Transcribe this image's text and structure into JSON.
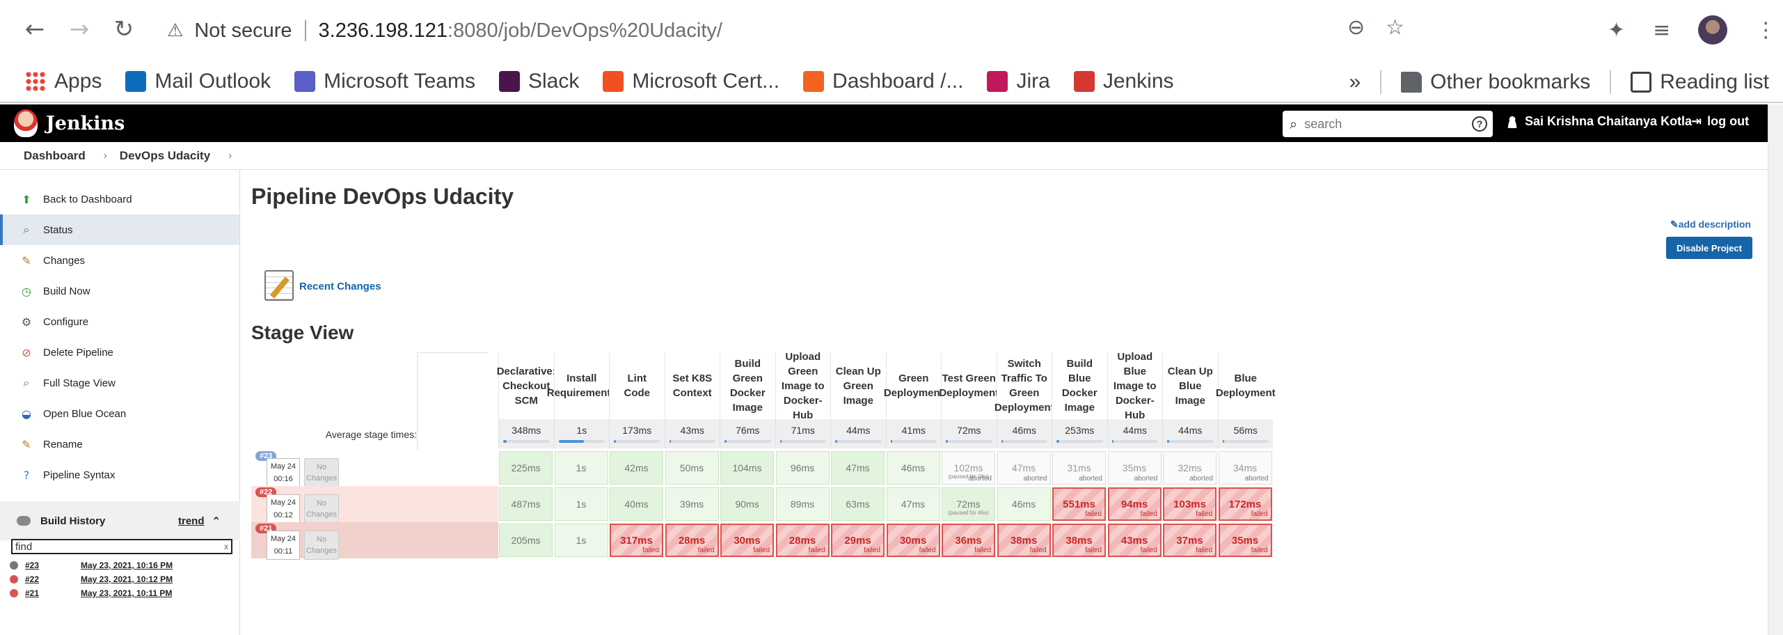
{
  "browser": {
    "security_label": "Not secure",
    "url_host": "3.236.198.121",
    "url_path": ":8080/job/DevOps%20Udacity/",
    "bookmarks": [
      {
        "label": "Apps",
        "color": "#ea4335"
      },
      {
        "label": "Mail Outlook",
        "color": "#0f6cbd"
      },
      {
        "label": "Microsoft Teams",
        "color": "#5b5fc7"
      },
      {
        "label": "Slack",
        "color": "#4a154b"
      },
      {
        "label": "Microsoft Cert...",
        "color": "#f25022"
      },
      {
        "label": "Dashboard /...",
        "color": "#f26322"
      },
      {
        "label": "Jira",
        "color": "#c2185b"
      },
      {
        "label": "Jenkins",
        "color": "#d33833"
      }
    ],
    "overflow": "»",
    "other_bookmarks": "Other bookmarks",
    "reading_list": "Reading list"
  },
  "jenkins": {
    "title": "Jenkins",
    "search_placeholder": "search",
    "help": "?",
    "user": "Sai Krishna Chaitanya Kotla",
    "logout": "log out"
  },
  "breadcrumb": {
    "root": "Dashboard",
    "job": "DevOps Udacity",
    "sep": "›"
  },
  "sidebar": {
    "tasks": [
      {
        "label": "Back to Dashboard",
        "icon": "up-arrow-icon"
      },
      {
        "label": "Status",
        "icon": "magnifier-icon"
      },
      {
        "label": "Changes",
        "icon": "notepad-icon"
      },
      {
        "label": "Build Now",
        "icon": "clock-icon"
      },
      {
        "label": "Configure",
        "icon": "gear-icon"
      },
      {
        "label": "Delete Pipeline",
        "icon": "no-entry-icon"
      },
      {
        "label": "Full Stage View",
        "icon": "magnifier-icon"
      },
      {
        "label": "Open Blue Ocean",
        "icon": "blue-ocean-icon"
      },
      {
        "label": "Rename",
        "icon": "notepad-icon"
      },
      {
        "label": "Pipeline Syntax",
        "icon": "help-icon"
      }
    ],
    "build_history": {
      "title": "Build History",
      "trend": "trend",
      "find_value": "find",
      "clear": "x",
      "builds": [
        {
          "number": "#23",
          "date": "May 23, 2021, 10:16 PM",
          "status_color": "#777777"
        },
        {
          "number": "#22",
          "date": "May 23, 2021, 10:12 PM",
          "status_color": "#d9534f"
        },
        {
          "number": "#21",
          "date": "May 23, 2021, 10:11 PM",
          "status_color": "#d9534f"
        }
      ]
    }
  },
  "main": {
    "title": "Pipeline DevOps Udacity",
    "add_description": "add description",
    "disable_button": "Disable Project",
    "recent_changes": "Recent Changes",
    "stage_view_title": "Stage View",
    "avg_label": "Average stage times:",
    "stages": [
      {
        "name": "Declarative: Checkout SCM",
        "avg": "348ms",
        "bar": 0.08
      },
      {
        "name": "Install Requirements",
        "avg": "1s",
        "bar": 0.55
      },
      {
        "name": "Lint Code",
        "avg": "173ms",
        "bar": 0.05
      },
      {
        "name": "Set K8S Context",
        "avg": "43ms",
        "bar": 0.02
      },
      {
        "name": "Build Green Docker Image",
        "avg": "76ms",
        "bar": 0.03
      },
      {
        "name": "Upload Green Image to Docker-Hub",
        "avg": "71ms",
        "bar": 0.03
      },
      {
        "name": "Clean Up Green Image",
        "avg": "44ms",
        "bar": 0.02
      },
      {
        "name": "Green Deployment",
        "avg": "41ms",
        "bar": 0.02
      },
      {
        "name": "Test Green Deployment",
        "avg": "72ms",
        "bar": 0.03
      },
      {
        "name": "Switch Traffic To Green Deployment",
        "avg": "46ms",
        "bar": 0.02
      },
      {
        "name": "Build Blue Docker Image",
        "avg": "253ms",
        "bar": 0.06
      },
      {
        "name": "Upload Blue Image to Docker-Hub",
        "avg": "44ms",
        "bar": 0.02
      },
      {
        "name": "Clean Up Blue Image",
        "avg": "44ms",
        "bar": 0.02
      },
      {
        "name": "Blue Deployment",
        "avg": "56ms",
        "bar": 0.02
      }
    ],
    "runs": [
      {
        "badge": "#23",
        "badge_color": "#7fa6d6",
        "date": "May 24",
        "time": "00:16",
        "changes": "No Changes",
        "row_color": "#ffffff",
        "cells": [
          {
            "t": "225ms",
            "s": "ok"
          },
          {
            "t": "1s",
            "s": "ok2"
          },
          {
            "t": "42ms",
            "s": "ok"
          },
          {
            "t": "50ms",
            "s": "ok2"
          },
          {
            "t": "104ms",
            "s": "ok"
          },
          {
            "t": "96ms",
            "s": "ok2"
          },
          {
            "t": "47ms",
            "s": "ok"
          },
          {
            "t": "46ms",
            "s": "ok2"
          },
          {
            "t": "102ms",
            "s": "ab",
            "tag": "aborted",
            "note": "(paused for 26s)"
          },
          {
            "t": "47ms",
            "s": "ab",
            "tag": "aborted"
          },
          {
            "t": "31ms",
            "s": "ab",
            "tag": "aborted"
          },
          {
            "t": "35ms",
            "s": "ab",
            "tag": "aborted"
          },
          {
            "t": "32ms",
            "s": "ab",
            "tag": "aborted"
          },
          {
            "t": "34ms",
            "s": "ab",
            "tag": "aborted"
          }
        ]
      },
      {
        "badge": "#22",
        "badge_color": "#d9534f",
        "date": "May 24",
        "time": "00:12",
        "changes": "No Changes",
        "row_color": "#fbe3e0",
        "cells": [
          {
            "t": "487ms",
            "s": "ok"
          },
          {
            "t": "1s",
            "s": "ok2"
          },
          {
            "t": "40ms",
            "s": "ok"
          },
          {
            "t": "39ms",
            "s": "ok2"
          },
          {
            "t": "90ms",
            "s": "ok"
          },
          {
            "t": "89ms",
            "s": "ok2"
          },
          {
            "t": "63ms",
            "s": "ok"
          },
          {
            "t": "47ms",
            "s": "ok2"
          },
          {
            "t": "72ms",
            "s": "ok",
            "note": "(paused for 46s)"
          },
          {
            "t": "46ms",
            "s": "ok2"
          },
          {
            "t": "551ms",
            "s": "fail",
            "tag": "failed"
          },
          {
            "t": "94ms",
            "s": "fail",
            "tag": "failed"
          },
          {
            "t": "103ms",
            "s": "fail",
            "tag": "failed"
          },
          {
            "t": "172ms",
            "s": "fail",
            "tag": "failed"
          }
        ]
      },
      {
        "badge": "#21",
        "badge_color": "#d9534f",
        "date": "May 24",
        "time": "00:11",
        "changes": "No Changes",
        "row_color": "#f2d0cc",
        "cells": [
          {
            "t": "205ms",
            "s": "ok"
          },
          {
            "t": "1s",
            "s": "ok2"
          },
          {
            "t": "317ms",
            "s": "fail",
            "tag": "failed"
          },
          {
            "t": "28ms",
            "s": "fail",
            "tag": "failed"
          },
          {
            "t": "30ms",
            "s": "fail",
            "tag": "failed"
          },
          {
            "t": "28ms",
            "s": "fail",
            "tag": "failed"
          },
          {
            "t": "29ms",
            "s": "fail",
            "tag": "failed"
          },
          {
            "t": "30ms",
            "s": "fail",
            "tag": "failed"
          },
          {
            "t": "36ms",
            "s": "fail",
            "tag": "failed"
          },
          {
            "t": "38ms",
            "s": "fail",
            "tag": "failed"
          },
          {
            "t": "38ms",
            "s": "fail",
            "tag": "failed"
          },
          {
            "t": "43ms",
            "s": "fail",
            "tag": "failed"
          },
          {
            "t": "37ms",
            "s": "fail",
            "tag": "failed"
          },
          {
            "t": "35ms",
            "s": "fail",
            "tag": "failed"
          }
        ]
      }
    ]
  }
}
